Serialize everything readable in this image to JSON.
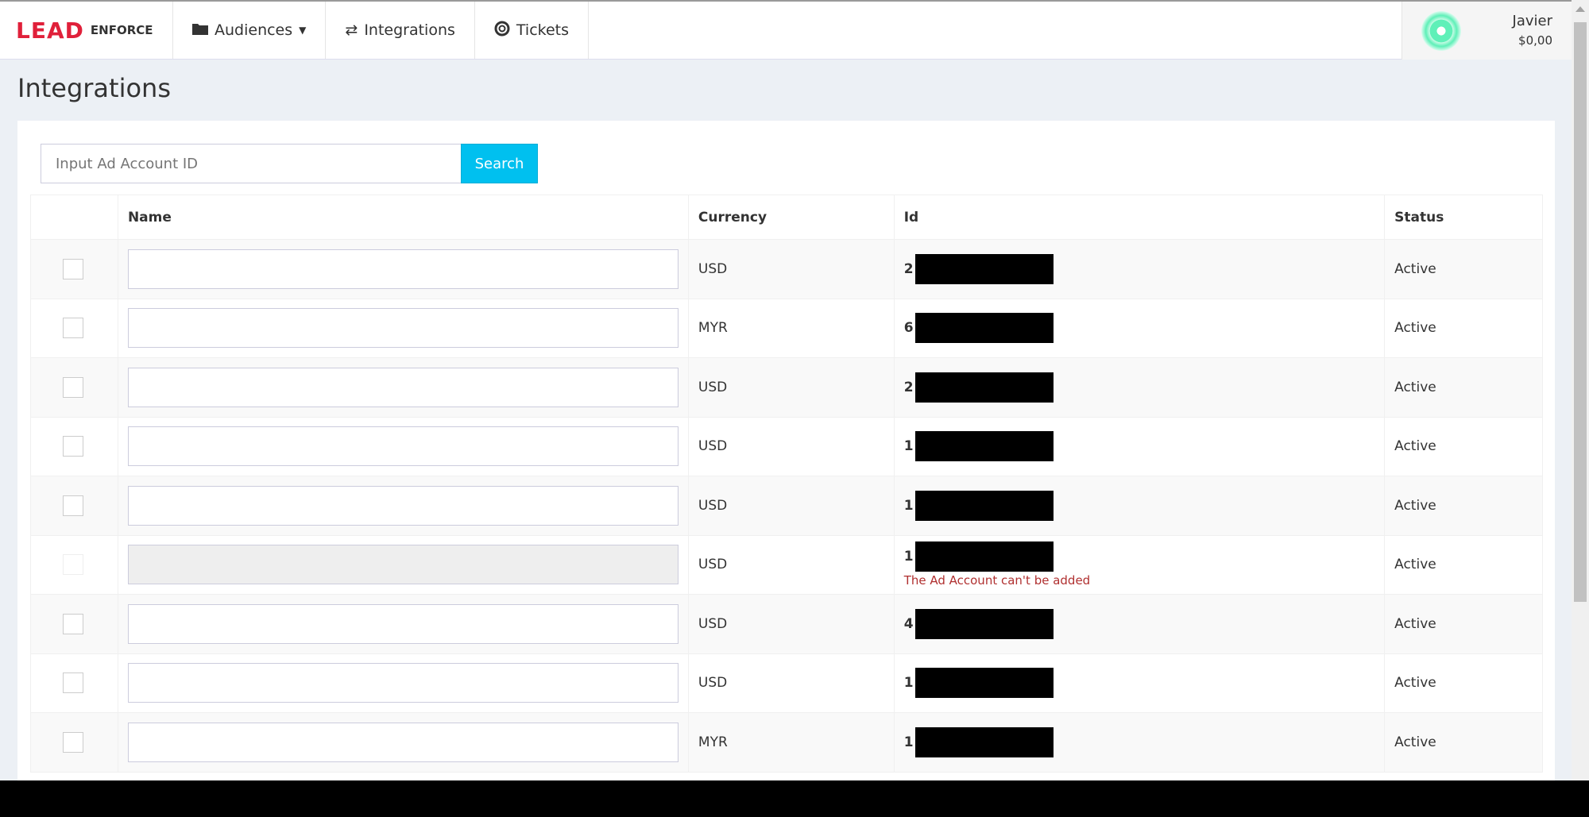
{
  "brand": {
    "logo_text": "LEAD",
    "logo_sub": "ENFORCE"
  },
  "nav": {
    "items": [
      {
        "label": "Audiences",
        "icon": "folder-icon"
      },
      {
        "label": "Integrations",
        "icon": "exchange-icon"
      },
      {
        "label": "Tickets",
        "icon": "life-ring-icon"
      }
    ]
  },
  "user": {
    "name": "Javier",
    "balance": "$0,00"
  },
  "page": {
    "title": "Integrations"
  },
  "search": {
    "placeholder": "Input Ad Account ID",
    "button": "Search"
  },
  "table": {
    "headers": [
      "",
      "Name",
      "Currency",
      "Id",
      "Status"
    ],
    "rows": [
      {
        "currency": "USD",
        "id_prefix": "2",
        "status": "Active",
        "disabled": false,
        "error": ""
      },
      {
        "currency": "MYR",
        "id_prefix": "6",
        "status": "Active",
        "disabled": false,
        "error": ""
      },
      {
        "currency": "USD",
        "id_prefix": "2",
        "status": "Active",
        "disabled": false,
        "error": ""
      },
      {
        "currency": "USD",
        "id_prefix": "1",
        "status": "Active",
        "disabled": false,
        "error": ""
      },
      {
        "currency": "USD",
        "id_prefix": "1",
        "status": "Active",
        "disabled": false,
        "error": ""
      },
      {
        "currency": "USD",
        "id_prefix": "1",
        "status": "Active",
        "disabled": true,
        "error": "The Ad Account can't be added"
      },
      {
        "currency": "USD",
        "id_prefix": "4",
        "status": "Active",
        "disabled": false,
        "error": ""
      },
      {
        "currency": "USD",
        "id_prefix": "1",
        "status": "Active",
        "disabled": false,
        "error": ""
      },
      {
        "currency": "MYR",
        "id_prefix": "1",
        "status": "Active",
        "disabled": false,
        "error": ""
      }
    ]
  },
  "colors": {
    "brand": "#e0203a",
    "accent": "#00c0ef",
    "error": "#b03030",
    "avatar": "#5ff0b8"
  }
}
